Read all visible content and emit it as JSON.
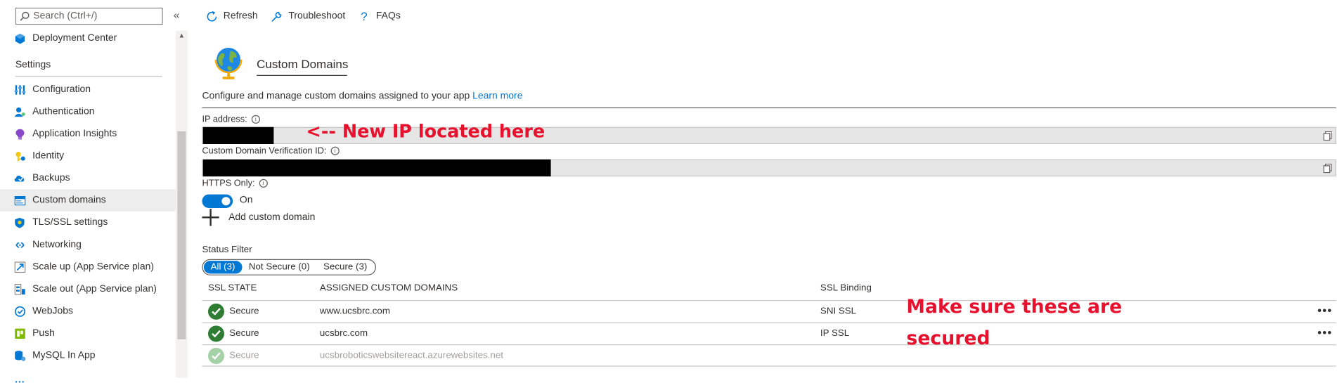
{
  "sidebar": {
    "search_placeholder": "Search (Ctrl+/)",
    "collapse_glyph": "«",
    "items_top": [
      {
        "label": "Deployment Center",
        "icon": "deployment-center-icon"
      }
    ],
    "section_header": "Settings",
    "items": [
      {
        "label": "Configuration",
        "icon": "configuration-icon"
      },
      {
        "label": "Authentication",
        "icon": "authentication-icon"
      },
      {
        "label": "Application Insights",
        "icon": "application-insights-icon"
      },
      {
        "label": "Identity",
        "icon": "identity-icon"
      },
      {
        "label": "Backups",
        "icon": "backups-icon"
      },
      {
        "label": "Custom domains",
        "icon": "custom-domains-icon",
        "active": true
      },
      {
        "label": "TLS/SSL settings",
        "icon": "tls-ssl-icon"
      },
      {
        "label": "Networking",
        "icon": "networking-icon"
      },
      {
        "label": "Scale up (App Service plan)",
        "icon": "scale-up-icon"
      },
      {
        "label": "Scale out (App Service plan)",
        "icon": "scale-out-icon"
      },
      {
        "label": "WebJobs",
        "icon": "webjobs-icon"
      },
      {
        "label": "Push",
        "icon": "push-icon"
      },
      {
        "label": "MySQL In App",
        "icon": "mysql-icon"
      }
    ]
  },
  "toolbar": {
    "refresh": "Refresh",
    "troubleshoot": "Troubleshoot",
    "faqs": "FAQs"
  },
  "page": {
    "title": "Custom Domains",
    "description": "Configure and manage custom domains assigned to your app",
    "learn_more": "Learn more"
  },
  "fields": {
    "ip_label": "IP address:",
    "verification_label": "Custom Domain Verification ID:",
    "https_label": "HTTPS Only:",
    "https_state": "On"
  },
  "annotations": {
    "ip_note": "<-- New IP located here",
    "secure_note": "Make sure these are secured"
  },
  "actions": {
    "add_domain": "Add custom domain"
  },
  "filter": {
    "label": "Status Filter",
    "options": [
      "All (3)",
      "Not Secure (0)",
      "Secure (3)"
    ],
    "selected": "All (3)"
  },
  "table": {
    "headers": [
      "SSL STATE",
      "ASSIGNED CUSTOM DOMAINS",
      "SSL Binding"
    ],
    "rows": [
      {
        "state": "Secure",
        "domain": "www.ucsbrc.com",
        "binding": "SNI SSL",
        "more": "•••"
      },
      {
        "state": "Secure",
        "domain": "ucsbrc.com",
        "binding": "IP SSL",
        "more": "•••"
      },
      {
        "state": "Secure",
        "domain": "ucsbroboticswebsitereact.azurewebsites.net",
        "binding": "",
        "more": ""
      }
    ]
  },
  "colors": {
    "accent": "#0078d4",
    "annotation": "#e8112d",
    "secure_green": "#2f7d32"
  }
}
